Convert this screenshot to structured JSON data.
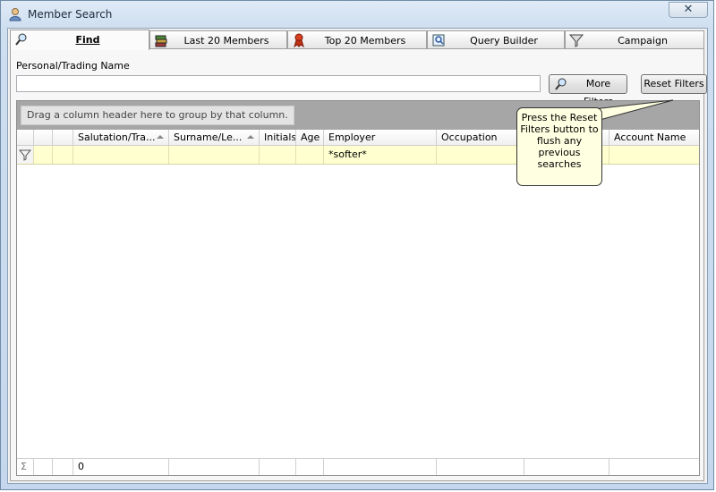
{
  "window": {
    "title": "Member Search",
    "close_glyph": "✕"
  },
  "tabs": [
    {
      "label": "Find",
      "icon": "magnifier-icon",
      "active": true
    },
    {
      "label": "Last 20 Members",
      "icon": "books-icon",
      "active": false
    },
    {
      "label": "Top 20 Members",
      "icon": "ribbon-icon",
      "active": false
    },
    {
      "label": "Query Builder",
      "icon": "query-icon",
      "active": false
    },
    {
      "label": "Campaign",
      "icon": "funnel-icon",
      "active": false
    }
  ],
  "search": {
    "label": "Personal/Trading Name",
    "value": ""
  },
  "buttons": {
    "more_filters": "More Filters",
    "reset_filters": "Reset Filters"
  },
  "grid": {
    "group_hint": "Drag a column header here to group by that column.",
    "columns": [
      "Salutation/Tra...",
      "Surname/Le...",
      "Initials",
      "Age",
      "Employer",
      "Occupation",
      "",
      "Account Name"
    ],
    "filter_row": {
      "employer": "*softer*"
    },
    "summary": {
      "count": "0",
      "sigma": "Σ"
    }
  },
  "callout": {
    "text": "Press the Reset Filters button to flush any previous searches"
  }
}
